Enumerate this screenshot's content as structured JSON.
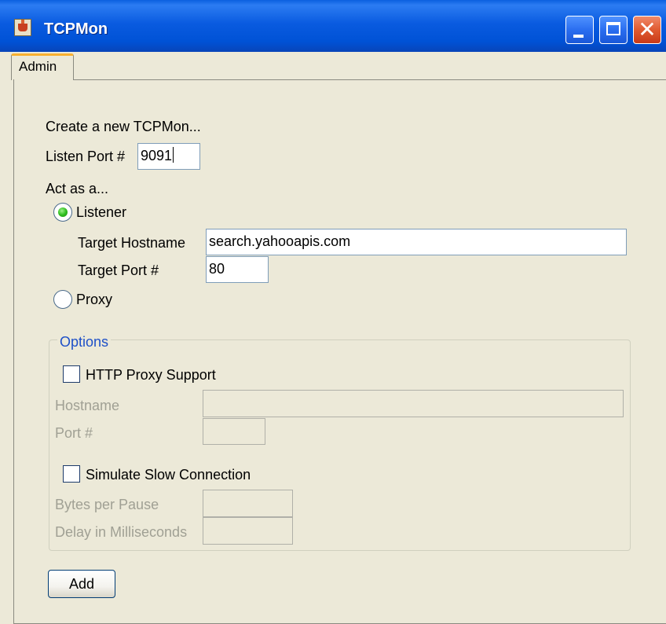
{
  "window": {
    "title": "TCPMon",
    "app_icon": "java-cup-icon"
  },
  "tabs": [
    {
      "label": "Admin",
      "selected": true
    }
  ],
  "admin": {
    "create_heading": "Create a new TCPMon...",
    "listen_port_label": "Listen Port #",
    "listen_port_value": "9091",
    "act_as_label": "Act as a...",
    "listener_label": "Listener",
    "listener_selected": true,
    "target_hostname_label": "Target Hostname",
    "target_hostname_value": "search.yahooapis.com",
    "target_port_label": "Target Port #",
    "target_port_value": "80",
    "proxy_label": "Proxy",
    "proxy_selected": false
  },
  "options": {
    "title": "Options",
    "http_proxy_label": "HTTP Proxy Support",
    "http_proxy_checked": false,
    "hostname_label": "Hostname",
    "hostname_value": "",
    "port_label": "Port #",
    "port_value": "",
    "simulate_slow_label": "Simulate Slow Connection",
    "simulate_slow_checked": false,
    "bytes_per_pause_label": "Bytes per Pause",
    "bytes_per_pause_value": "",
    "delay_label": "Delay in Milliseconds",
    "delay_value": ""
  },
  "buttons": {
    "add_label": "Add"
  },
  "colors": {
    "titlebar": "#0a5be0",
    "window_bg": "#ece9d8",
    "group_title": "#1e50c8",
    "tab_highlight": "#f8b030"
  }
}
